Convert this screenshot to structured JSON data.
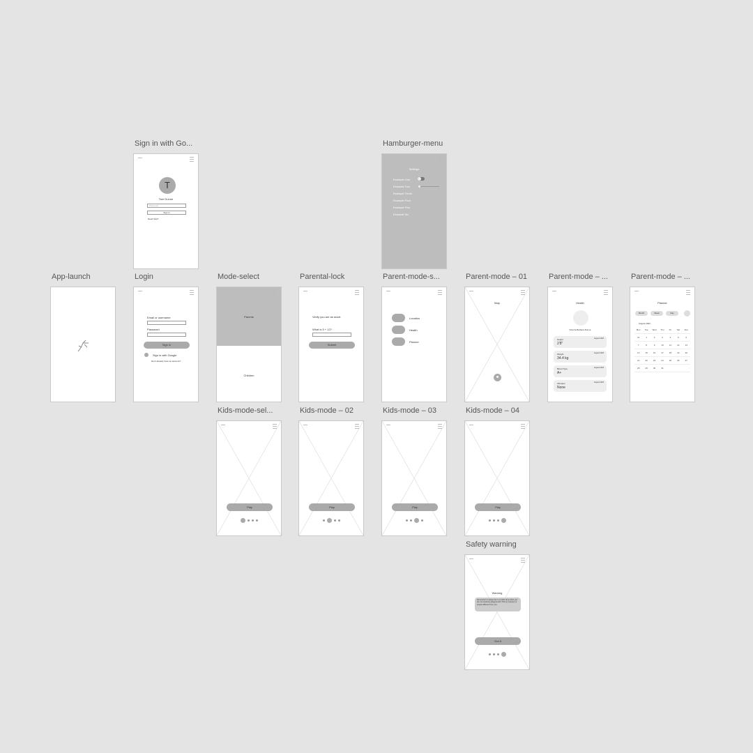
{
  "screen_labels": {
    "sign_in_google": "Sign in with Go...",
    "hamburger_menu": "Hamburger-menu",
    "app_launch": "App-launch",
    "login": "Login",
    "mode_select": "Mode-select",
    "parental_lock": "Parental-lock",
    "parent_mode_select": "Parent-mode-s...",
    "parent_mode_01": "Parent-mode – 01",
    "parent_mode_02": "Parent-mode – ...",
    "parent_mode_03": "Parent-mode – ...",
    "kids_mode_select": "Kids-mode-sel...",
    "kids_mode_02": "Kids-mode – 02",
    "kids_mode_03": "Kids-mode – 03",
    "kids_mode_04": "Kids-mode – 04",
    "safety_warning": "Safety warning"
  },
  "sign_in_google": {
    "avatar_letter": "T",
    "name": "Tom Dunne",
    "password_placeholder": "Password",
    "sign_in": "Sign in",
    "help": "Need help?"
  },
  "hamburger_menu": {
    "title": "Settings",
    "items": [
      "Example One",
      "Example Two",
      "Example Three",
      "Example Four",
      "Example Five",
      "Example Six"
    ]
  },
  "login": {
    "email_label": "Email or username",
    "password_label": "Password",
    "sign_in": "Sign in",
    "google": "Sign in with Google",
    "no_account": "Don't already have an account?"
  },
  "mode_select": {
    "parents": "Parents",
    "children": "Children"
  },
  "parental_lock": {
    "verify": "Verify you are an adult.",
    "question": "What is 5 + 12?",
    "submit": "Submit"
  },
  "parent_mode_select": {
    "options": [
      "Location",
      "Health",
      "Planner"
    ]
  },
  "parent_mode_01": {
    "title": "Map"
  },
  "health": {
    "title": "Health",
    "name": "Victoria Barbara Dunne",
    "cards": [
      {
        "label": "Height",
        "value": "2'8\"",
        "date": "August 2023"
      },
      {
        "label": "Weight",
        "value": "34.4 kg",
        "date": "August 2023"
      },
      {
        "label": "Blood Type",
        "value": "A+",
        "date": "August 2023"
      },
      {
        "label": "Allergies",
        "value": "None",
        "date": "August 2023"
      }
    ]
  },
  "planner": {
    "title": "Planner",
    "tabs": [
      "Month",
      "Week",
      "Day"
    ],
    "month": "August 2023",
    "weekdays": [
      "Mon",
      "Tue",
      "Wed",
      "Thu",
      "Fri",
      "Sat",
      "Sun"
    ],
    "weeks": [
      [
        "31",
        "1",
        "2",
        "3",
        "4",
        "5",
        "6"
      ],
      [
        "7",
        "8",
        "9",
        "10",
        "11",
        "12",
        "13"
      ],
      [
        "14",
        "15",
        "16",
        "17",
        "18",
        "19",
        "20"
      ],
      [
        "21",
        "22",
        "23",
        "24",
        "25",
        "26",
        "27"
      ],
      [
        "28",
        "29",
        "30",
        "31",
        "",
        "",
        ""
      ]
    ]
  },
  "kids": {
    "play": "Play"
  },
  "safety_warning": {
    "title": "Warning",
    "message": "Remember to always be in a public area when you are out exploring playgrounds. Pick up property or people different from you.",
    "got_it": "Got It"
  }
}
